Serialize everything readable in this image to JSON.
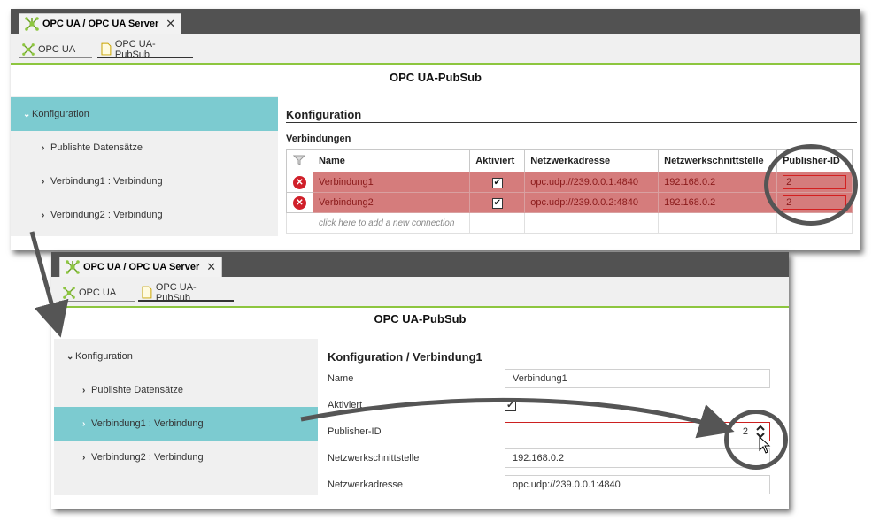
{
  "window1": {
    "tab": {
      "label": "OPC UA / OPC UA Server",
      "close": "✕"
    },
    "subtabs": [
      "OPC UA",
      "OPC UA-PubSub"
    ],
    "page_title": "OPC UA-PubSub",
    "sidebar": {
      "items": [
        {
          "chevron": "⌄",
          "label": "Konfiguration"
        },
        {
          "chevron": "›",
          "label": "Publishte Datensätze"
        },
        {
          "chevron": "›",
          "label": "Verbindung1 : Verbindung"
        },
        {
          "chevron": "›",
          "label": "Verbindung2 : Verbindung"
        }
      ]
    },
    "section_title": "Konfiguration",
    "table_caption": "Verbindungen",
    "columns": [
      "Name",
      "Aktiviert",
      "Netzwerkadresse",
      "Netzwerkschnittstelle",
      "Publisher-ID"
    ],
    "rows": [
      {
        "name": "Verbindung1",
        "aktiviert": "✔",
        "adresse": "opc.udp://239.0.0.1:4840",
        "schnittstelle": "192.168.0.2",
        "publisher_id": "2"
      },
      {
        "name": "Verbindung2",
        "aktiviert": "✔",
        "adresse": "opc.udp://239.0.0.2:4840",
        "schnittstelle": "192.168.0.2",
        "publisher_id": "2"
      }
    ],
    "add_row": "click here to add a new connection"
  },
  "window2": {
    "tab": {
      "label": "OPC UA / OPC UA Server",
      "close": "✕"
    },
    "subtabs": [
      "OPC UA",
      "OPC UA-PubSub"
    ],
    "page_title": "OPC UA-PubSub",
    "sidebar": {
      "items": [
        {
          "chevron": "⌄",
          "label": "Konfiguration"
        },
        {
          "chevron": "›",
          "label": "Publishte Datensätze"
        },
        {
          "chevron": "›",
          "label": "Verbindung1 : Verbindung"
        },
        {
          "chevron": "›",
          "label": "Verbindung2 : Verbindung"
        }
      ]
    },
    "section_title": "Konfiguration / Verbindung1",
    "form": {
      "name_label": "Name",
      "name_value": "Verbindung1",
      "aktiviert_label": "Aktiviert",
      "publisher_label": "Publisher-ID",
      "publisher_value": "2",
      "interface_label": "Netzwerkschnittstelle",
      "interface_value": "192.168.0.2",
      "address_label": "Netzwerkadresse",
      "address_value": "opc.udp://239.0.0.1:4840"
    }
  },
  "colors": {
    "tabbar": "#525252",
    "accent_green": "#8dc63f",
    "selection_teal": "#7ccbd0",
    "error_row": "#d57c7c",
    "error_red": "#d0202a"
  }
}
